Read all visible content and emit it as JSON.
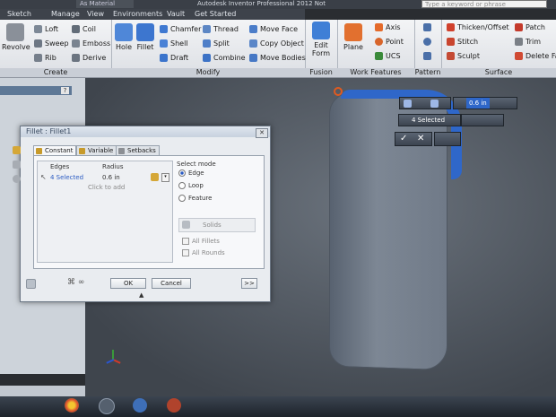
{
  "app": {
    "title": "Autodesk Inventor Professional 2012 Not",
    "material": "As Material",
    "search_placeholder": "Type a keyword or phrase"
  },
  "menubar": {
    "items": [
      "Sketch",
      "Manage",
      "View",
      "Environments",
      "Vault",
      "Get Started"
    ]
  },
  "ribbon": {
    "create": {
      "label": "Create",
      "revolve": "Revolve",
      "loft": "Loft",
      "sweep": "Sweep",
      "rib": "Rib",
      "coil": "Coil",
      "emboss": "Emboss",
      "derive": "Derive"
    },
    "modify": {
      "label": "Modify",
      "hole": "Hole",
      "fillet": "Fillet",
      "chamfer": "Chamfer",
      "shell": "Shell",
      "draft": "Draft",
      "thread": "Thread",
      "split": "Split",
      "combine": "Combine",
      "move_face": "Move Face",
      "copy_object": "Copy Object",
      "move_bodies": "Move Bodies"
    },
    "fusion": {
      "label": "Fusion",
      "edit_form": "Edit\nForm"
    },
    "work_features": {
      "label": "Work Features",
      "plane": "Plane",
      "axis": "Axis",
      "point": "Point",
      "ucs": "UCS"
    },
    "pattern": {
      "label": "Pattern"
    },
    "surface": {
      "label": "Surface",
      "thicken": "Thicken/Offset",
      "stitch": "Stitch",
      "sculpt": "Sculpt",
      "patch": "Patch",
      "trim": "Trim",
      "delete_face": "Delete Fa"
    }
  },
  "dialog": {
    "title": "Fillet : Fillet1",
    "tabs": [
      "Constant",
      "Variable",
      "Setbacks"
    ],
    "table": {
      "col_edges": "Edges",
      "col_radius": "Radius",
      "row_edges": "4 Selected",
      "row_radius": "0.6 in",
      "add_row": "Click to add"
    },
    "select_mode": {
      "label": "Select mode",
      "edge": "Edge",
      "loop": "Loop",
      "feature": "Feature"
    },
    "solids": "Solids",
    "all_fillets": "All Fillets",
    "all_rounds": "All Rounds",
    "ok": "OK",
    "cancel": "Cancel",
    "more": ">>"
  },
  "mini_toolbar": {
    "radius_value": "0.6 in",
    "selected": "4 Selected"
  },
  "colors": {
    "accent": "#2f67c9",
    "ribbon_bg": "#e3e6ea",
    "viewport": "#5a616b"
  }
}
